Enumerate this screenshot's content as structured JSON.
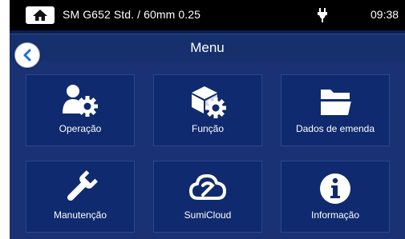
{
  "status_bar": {
    "fiber_profile": "SM G652 Std. / 60mm 0.25",
    "time": "09:38",
    "home_icon": "home-icon",
    "power_icon": "plug-icon"
  },
  "header": {
    "title": "Menu",
    "back_icon": "chevron-left-icon"
  },
  "menu_items": [
    {
      "label": "Operação",
      "icon": "operator-gear-icon"
    },
    {
      "label": "Função",
      "icon": "box-gear-icon"
    },
    {
      "label": "Dados de emenda",
      "icon": "folder-icon"
    },
    {
      "label": "Manutenção",
      "icon": "wrench-icon"
    },
    {
      "label": "SumiCloud",
      "icon": "cloud-icon"
    },
    {
      "label": "Informação",
      "icon": "info-icon"
    }
  ],
  "colors": {
    "background": "#0d1d4d",
    "tile": "#0f2a6e",
    "status_bar": "#000000",
    "accent": "#1d6fd6"
  }
}
